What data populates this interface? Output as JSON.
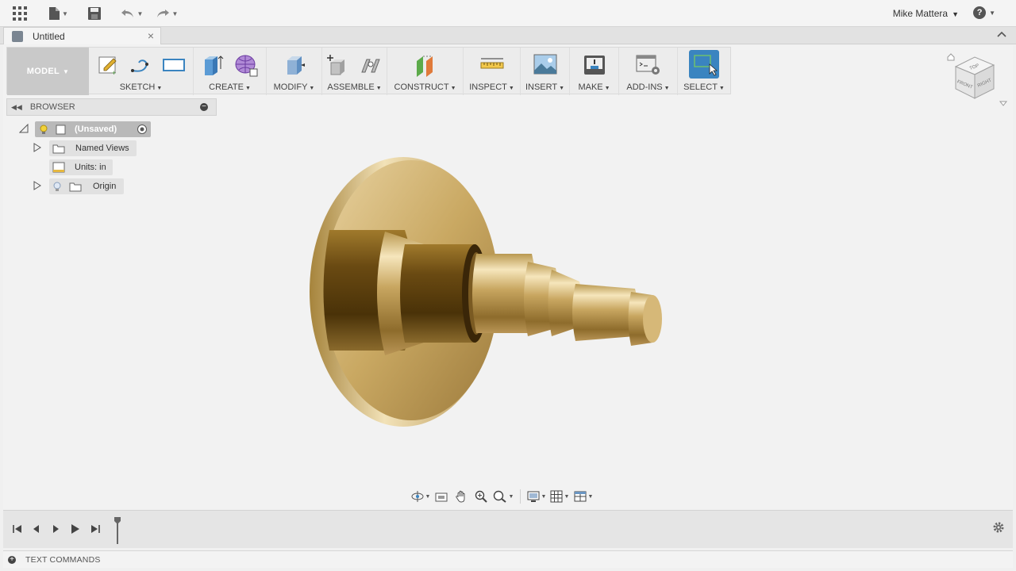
{
  "appbar": {
    "user_name": "Mike Mattera",
    "icons": [
      "grid-menu-icon",
      "file-icon",
      "save-icon",
      "undo-icon",
      "redo-icon",
      "help-icon"
    ]
  },
  "tab": {
    "title": "Untitled",
    "close_glyph": "×"
  },
  "toolbar": {
    "workspace_label": "MODEL",
    "groups": [
      {
        "id": "sketch",
        "label": "SKETCH"
      },
      {
        "id": "create",
        "label": "CREATE"
      },
      {
        "id": "modify",
        "label": "MODIFY"
      },
      {
        "id": "assemble",
        "label": "ASSEMBLE"
      },
      {
        "id": "construct",
        "label": "CONSTRUCT"
      },
      {
        "id": "inspect",
        "label": "INSPECT"
      },
      {
        "id": "insert",
        "label": "INSERT"
      },
      {
        "id": "make",
        "label": "MAKE"
      },
      {
        "id": "addins",
        "label": "ADD-INS"
      },
      {
        "id": "select",
        "label": "SELECT"
      }
    ]
  },
  "browser": {
    "title": "BROWSER",
    "items": [
      {
        "label": "(Unsaved)"
      },
      {
        "label": "Named Views"
      },
      {
        "label": "Units: in"
      },
      {
        "label": "Origin"
      }
    ]
  },
  "viewcube": {
    "top": "TOP",
    "front": "FRONT",
    "right": "RIGHT"
  },
  "text_commands": {
    "label": "TEXT COMMANDS"
  },
  "colors": {
    "accent": "#3a84c0",
    "brass": "#c9a862"
  }
}
